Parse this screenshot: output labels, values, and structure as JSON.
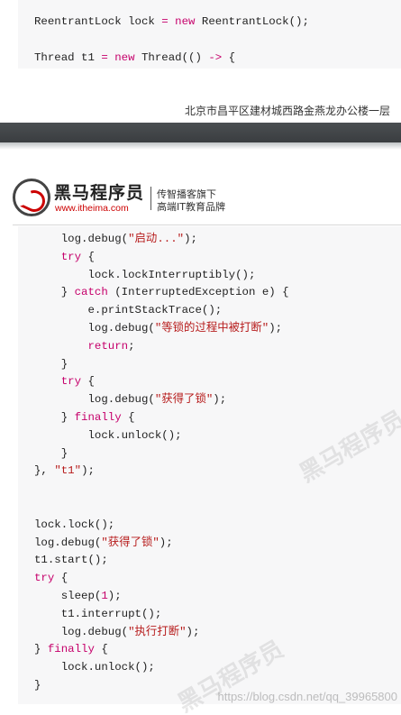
{
  "code_top": [
    [
      {
        "t": "ReentrantLock lock "
      },
      {
        "t": "=",
        "c": "kw"
      },
      {
        "t": " "
      },
      {
        "t": "new",
        "c": "kw"
      },
      {
        "t": " ReentrantLock();"
      }
    ],
    [],
    [
      {
        "t": "Thread t1 "
      },
      {
        "t": "=",
        "c": "kw"
      },
      {
        "t": " "
      },
      {
        "t": "new",
        "c": "kw"
      },
      {
        "t": " Thread(() "
      },
      {
        "t": "->",
        "c": "kw"
      },
      {
        "t": " {"
      }
    ]
  ],
  "footer": {
    "address": "北京市昌平区建材城西路金燕龙办公楼一层"
  },
  "brand": {
    "name": "黑马程序员",
    "url": "www.itheima.com",
    "tagline_1": "传智播客旗下",
    "tagline_2": "高端IT教育品牌"
  },
  "code_bottom": [
    [
      {
        "t": "    log.debug("
      },
      {
        "t": "\"启动...\"",
        "c": "str"
      },
      {
        "t": ");"
      }
    ],
    [
      {
        "t": "    "
      },
      {
        "t": "try",
        "c": "kw"
      },
      {
        "t": " {"
      }
    ],
    [
      {
        "t": "        lock.lockInterruptibly();"
      }
    ],
    [
      {
        "t": "    } "
      },
      {
        "t": "catch",
        "c": "kw"
      },
      {
        "t": " (InterruptedException e) {"
      }
    ],
    [
      {
        "t": "        e.printStackTrace();"
      }
    ],
    [
      {
        "t": "        log.debug("
      },
      {
        "t": "\"等锁的过程中被打断\"",
        "c": "str"
      },
      {
        "t": ");"
      }
    ],
    [
      {
        "t": "        "
      },
      {
        "t": "return",
        "c": "kw"
      },
      {
        "t": ";"
      }
    ],
    [
      {
        "t": "    }"
      }
    ],
    [
      {
        "t": "    "
      },
      {
        "t": "try",
        "c": "kw"
      },
      {
        "t": " {"
      }
    ],
    [
      {
        "t": "        log.debug("
      },
      {
        "t": "\"获得了锁\"",
        "c": "str"
      },
      {
        "t": ");"
      }
    ],
    [
      {
        "t": "    } "
      },
      {
        "t": "finally",
        "c": "kw"
      },
      {
        "t": " {"
      }
    ],
    [
      {
        "t": "        lock.unlock();"
      }
    ],
    [
      {
        "t": "    }"
      }
    ],
    [
      {
        "t": "}, "
      },
      {
        "t": "\"t1\"",
        "c": "str"
      },
      {
        "t": ");"
      }
    ],
    [],
    [],
    [
      {
        "t": "lock.lock();"
      }
    ],
    [
      {
        "t": "log.debug("
      },
      {
        "t": "\"获得了锁\"",
        "c": "str"
      },
      {
        "t": ");"
      }
    ],
    [
      {
        "t": "t1.start();"
      }
    ],
    [
      {
        "t": "try",
        "c": "kw"
      },
      {
        "t": " {"
      }
    ],
    [
      {
        "t": "    sleep("
      },
      {
        "t": "1",
        "c": "num"
      },
      {
        "t": ");"
      }
    ],
    [
      {
        "t": "    t1.interrupt();"
      }
    ],
    [
      {
        "t": "    log.debug("
      },
      {
        "t": "\"执行打断\"",
        "c": "str"
      },
      {
        "t": ");"
      }
    ],
    [
      {
        "t": "} "
      },
      {
        "t": "finally",
        "c": "kw"
      },
      {
        "t": " {"
      }
    ],
    [
      {
        "t": "    lock.unlock();"
      }
    ],
    [
      {
        "t": "}"
      }
    ]
  ],
  "watermark": {
    "brand_text": "黑马程序员",
    "csdn_url": "https://blog.csdn.net/qq_39965800"
  }
}
